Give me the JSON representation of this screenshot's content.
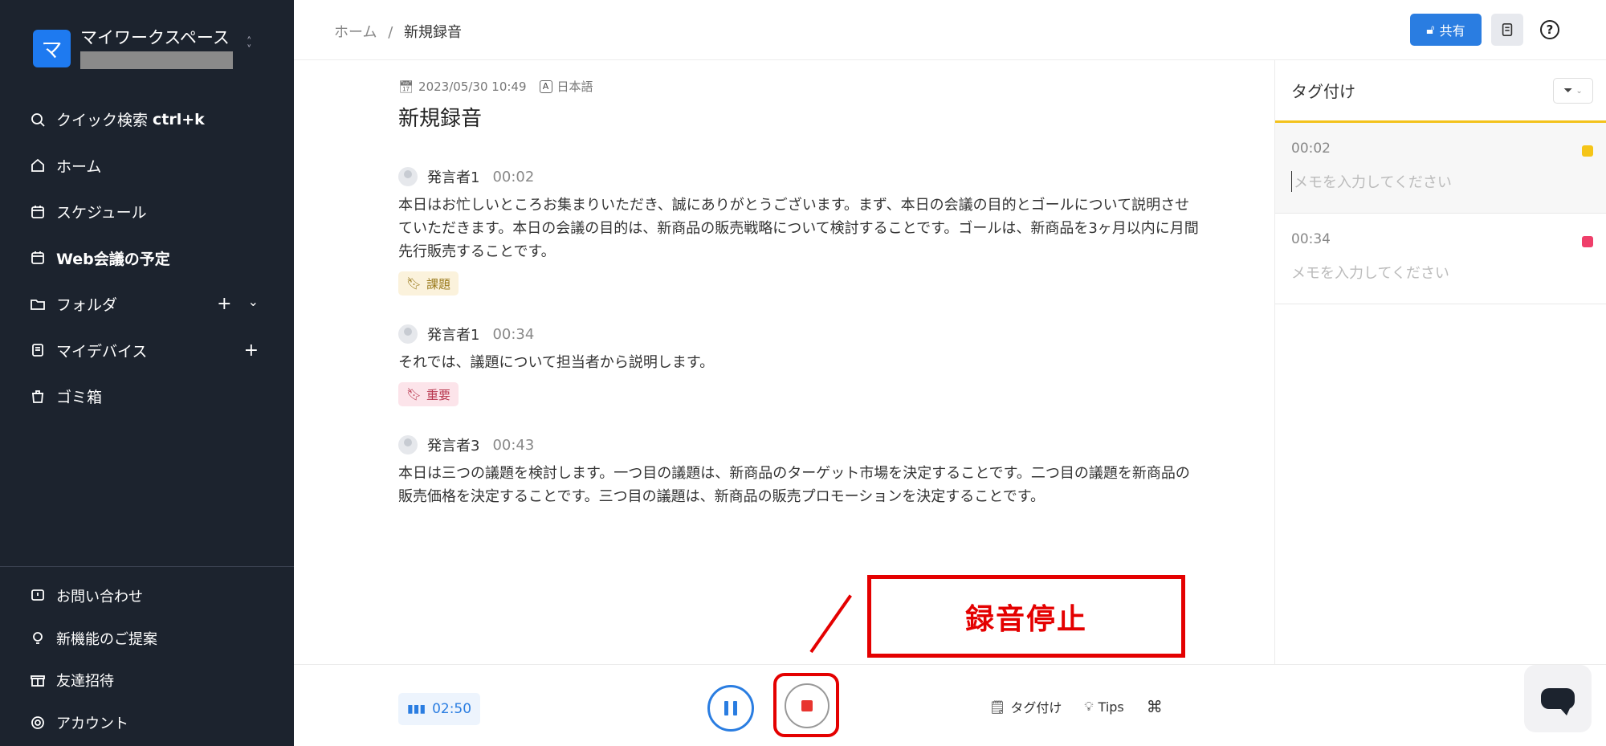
{
  "workspace": {
    "initial": "マ",
    "name": "マイワークスペース"
  },
  "sidebar": {
    "items": [
      {
        "label": "クイック検索",
        "shortcut": "ctrl+k"
      },
      {
        "label": "ホーム"
      },
      {
        "label": "スケジュール"
      },
      {
        "label": "Web会議の予定"
      },
      {
        "label": "フォルダ"
      },
      {
        "label": "マイデバイス"
      },
      {
        "label": "ゴミ箱"
      }
    ],
    "bottom": [
      {
        "label": "お問い合わせ"
      },
      {
        "label": "新機能のご提案"
      },
      {
        "label": "友達招待"
      },
      {
        "label": "アカウント"
      }
    ]
  },
  "breadcrumb": {
    "home": "ホーム",
    "sep": "/",
    "current": "新規録音"
  },
  "header": {
    "share_label": "共有",
    "help": "?"
  },
  "recording": {
    "datetime": "2023/05/30 10:49",
    "language_badge": "A",
    "language": "日本語",
    "title": "新規録音"
  },
  "transcript": [
    {
      "speaker": "発言者1",
      "time": "00:02",
      "text": "本日はお忙しいところお集まりいただき、誠にありがとうございます。まず、本日の会議の目的とゴールについて説明させていただきます。本日の会議の目的は、新商品の販売戦略について検討することです。ゴールは、新商品を3ヶ月以内に月間先行販売することです。",
      "tag": "課題"
    },
    {
      "speaker": "発言者1",
      "time": "00:34",
      "text": "それでは、議題について担当者から説明します。",
      "tag": "重要"
    },
    {
      "speaker": "発言者3",
      "time": "00:43",
      "text": "本日は三つの議題を検討します。一つ目の議題は、新商品のターゲット市場を決定することです。二つ目の議題を新商品の販売価格を決定することです。三つ目の議題は、新商品の販売プロモーションを決定することです。"
    }
  ],
  "tag_panel": {
    "title": "タグ付け",
    "cards": [
      {
        "time": "00:02",
        "placeholder": "メモを入力してください",
        "color": "#f5c518"
      },
      {
        "time": "00:34",
        "placeholder": "メモを入力してください",
        "color": "#ef3f6a"
      }
    ]
  },
  "player": {
    "elapsed": "02:50",
    "tools": {
      "tag": "タグ付け",
      "tips": "Tips"
    }
  },
  "callout": {
    "label": "録音停止"
  },
  "colors": {
    "accent": "#2a7de1",
    "sidebar_bg": "#1c232e",
    "stop_red": "#e40000"
  }
}
